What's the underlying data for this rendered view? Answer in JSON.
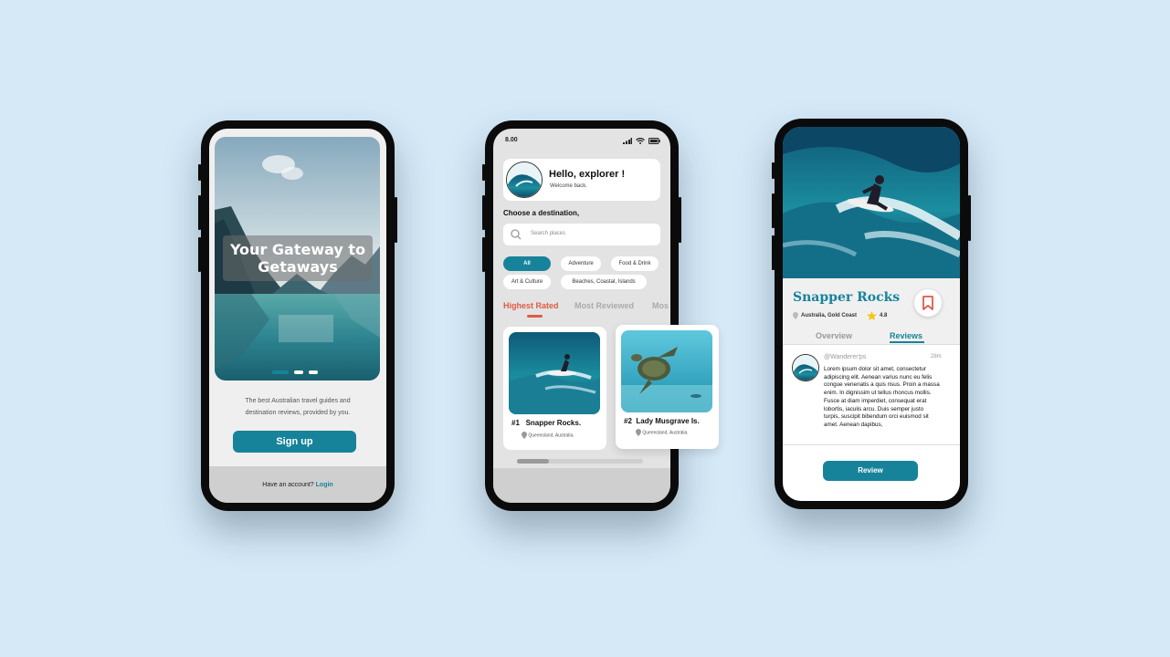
{
  "colors": {
    "background": "#d5e9f7",
    "accent": "#17839a",
    "highlight": "#e05a44",
    "star": "#f5c518"
  },
  "onboarding": {
    "hero_title": "Your Gateway to Getaways",
    "tagline": "The best Australian travel guides and destination reviews, provided by you.",
    "signup_label": "Sign up",
    "login_prompt": "Have an account?",
    "login_link": "Login",
    "carousel_index": 1,
    "carousel_count": 3
  },
  "home": {
    "status_time": "8.00",
    "greeting": "Hello, explorer !",
    "greeting_sub": "Welcome back.",
    "choose_label": "Choose a destination,",
    "search_placeholder": "Search places",
    "chips": [
      "All",
      "Adventure",
      "Food & Drink",
      "Art & Culture",
      "Beaches, Coastal, Islands"
    ],
    "active_chip": "All",
    "category_tabs": [
      "Highest Rated",
      "Most Reviewed",
      "Mos"
    ],
    "active_tab": "Highest Rated",
    "cards": [
      {
        "rank": "#1",
        "name": "Snapper Rocks.",
        "location": "Queensland, Australia."
      },
      {
        "rank": "#2",
        "name": "Lady Musgrave Is.",
        "location": "Queensland, Australia."
      }
    ]
  },
  "detail": {
    "title": "Snapper Rocks",
    "location": "Australia, Gold Coast",
    "rating": "4.8",
    "tabs": [
      "Overview",
      "Reviews"
    ],
    "active_tab": "Reviews",
    "review": {
      "user": "@Wanderer'ps",
      "time": "28m",
      "text": "Lorem ipsum dolor sit amet, consectetur adipiscing elit. Aenean varius nunc eu felis congue venenatis a quis risus. Proin a massa enim. In dignissim ut tellus rhoncus mollis. Fusce at diam imperdiet, consequat erat lobortis, iaculis arcu. Duis semper justo turpis, suscipit bibendum orci euismod sit amet. Aenean dapibus,"
    },
    "review_button": "Review"
  }
}
